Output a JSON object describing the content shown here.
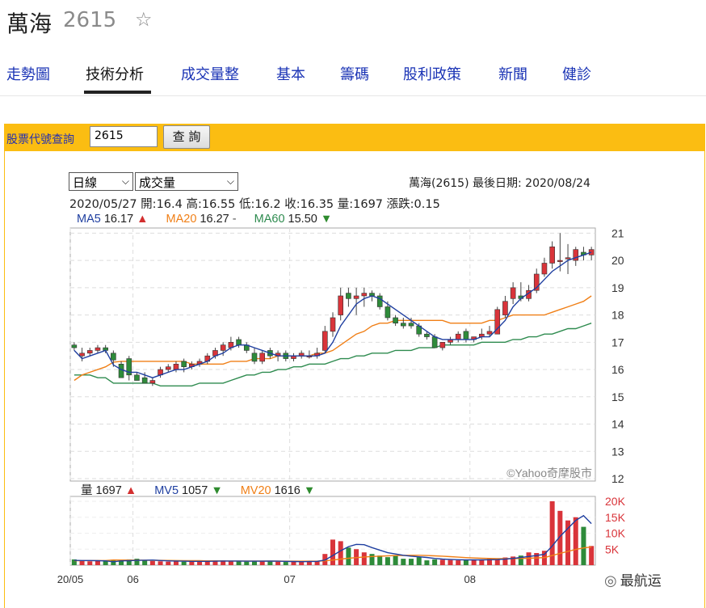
{
  "header": {
    "name": "萬海",
    "code": "2615"
  },
  "tabs": [
    "走勢圖",
    "技術分析",
    "成交量整",
    "基本",
    "籌碼",
    "股利政策",
    "新聞",
    "健診"
  ],
  "query": {
    "label": "股票代號查詢",
    "value": "2615",
    "button": "查 詢"
  },
  "selectors": {
    "period": "日線",
    "indicator": "成交量"
  },
  "info": {
    "title": "萬海(2615)   最後日期: 2020/08/24",
    "ohlc": "2020/05/27  開:16.4  高:16.55  低:16.2  收:16.35  量:1697  漲跌:0.15"
  },
  "ma_legend": [
    {
      "label": "MA5",
      "value": "16.17",
      "arrow": "▲",
      "color": "#1f3fa0",
      "arrow_color": "#d32f2f"
    },
    {
      "label": "MA20",
      "value": "16.27",
      "arrow": "-",
      "color": "#f07f16",
      "arrow_color": "#555555"
    },
    {
      "label": "MA60",
      "value": "15.50",
      "arrow": "▼",
      "color": "#2e8b4f",
      "arrow_color": "#2e8b2e"
    }
  ],
  "vol_legend": [
    {
      "label": "量",
      "value": "1697",
      "arrow": "▲",
      "color": "#222222",
      "arrow_color": "#d32f2f"
    },
    {
      "label": "MV5",
      "value": "1057",
      "arrow": "▼",
      "color": "#1f3fa0",
      "arrow_color": "#2e8b2e"
    },
    {
      "label": "MV20",
      "value": "1616",
      "arrow": "▼",
      "color": "#f07f16",
      "arrow_color": "#2e8b2e"
    }
  ],
  "watermark_chart": "©Yahoo奇摩股市",
  "watermark_corner": "最航运",
  "colors": {
    "up": "#d9343a",
    "down": "#2e8b3a",
    "ma5": "#1f3fa0",
    "ma20": "#f07f16",
    "ma60": "#2e8b4f",
    "vtick": "#d9343a"
  },
  "chart_data": {
    "type": "candlestick",
    "dates": [
      "05/20",
      "05/21",
      "05/22",
      "05/25",
      "05/26",
      "05/27",
      "05/28",
      "05/29",
      "06/01",
      "06/02",
      "06/03",
      "06/04",
      "06/05",
      "06/08",
      "06/09",
      "06/10",
      "06/11",
      "06/12",
      "06/15",
      "06/16",
      "06/17",
      "06/18",
      "06/19",
      "06/22",
      "06/23",
      "06/24",
      "06/29",
      "06/30",
      "07/01",
      "07/02",
      "07/03",
      "07/06",
      "07/07",
      "07/08",
      "07/09",
      "07/10",
      "07/13",
      "07/14",
      "07/15",
      "07/16",
      "07/17",
      "07/20",
      "07/21",
      "07/22",
      "07/23",
      "07/24",
      "07/27",
      "07/28",
      "07/29",
      "07/30",
      "07/31",
      "08/03",
      "08/04",
      "08/05",
      "08/06",
      "08/07",
      "08/10",
      "08/11",
      "08/12",
      "08/13",
      "08/14",
      "08/17",
      "08/18",
      "08/19",
      "08/20",
      "08/21",
      "08/24"
    ],
    "open": [
      16.9,
      16.5,
      16.6,
      16.7,
      16.8,
      16.6,
      16.2,
      16.4,
      15.8,
      15.7,
      15.5,
      15.8,
      16.0,
      16.0,
      16.3,
      16.1,
      16.2,
      16.3,
      16.5,
      16.7,
      16.8,
      17.1,
      16.9,
      16.6,
      16.3,
      16.7,
      16.5,
      16.6,
      16.4,
      16.5,
      16.5,
      16.5,
      16.7,
      17.4,
      18.0,
      18.8,
      18.6,
      18.7,
      18.8,
      18.7,
      18.3,
      17.9,
      17.7,
      17.7,
      17.6,
      17.3,
      17.2,
      16.8,
      17.0,
      17.1,
      17.4,
      17.1,
      17.2,
      17.3,
      17.3,
      18.0,
      18.6,
      18.7,
      18.6,
      18.9,
      19.5,
      19.9,
      20.0,
      20.1,
      20.0,
      20.3,
      20.2
    ],
    "high": [
      17.0,
      16.8,
      16.8,
      16.9,
      16.9,
      16.7,
      16.3,
      16.5,
      15.9,
      15.9,
      15.7,
      16.1,
      16.2,
      16.3,
      16.4,
      16.3,
      16.4,
      16.6,
      16.8,
      17.0,
      17.2,
      17.2,
      17.0,
      16.8,
      16.7,
      16.8,
      16.7,
      16.7,
      16.6,
      16.7,
      16.7,
      16.8,
      17.6,
      18.1,
      19.0,
      19.0,
      19.0,
      19.0,
      18.9,
      18.8,
      18.5,
      18.0,
      17.9,
      17.9,
      17.7,
      17.4,
      17.3,
      17.0,
      17.2,
      17.4,
      17.5,
      17.2,
      17.5,
      17.6,
      18.3,
      18.7,
      19.2,
      19.2,
      19.1,
      19.7,
      20.1,
      20.7,
      21.0,
      20.6,
      20.5,
      20.5,
      20.5
    ],
    "low": [
      16.7,
      16.3,
      16.5,
      16.6,
      16.6,
      16.1,
      15.7,
      15.6,
      15.6,
      15.5,
      15.4,
      15.7,
      15.9,
      15.9,
      15.9,
      16.0,
      16.1,
      16.2,
      16.4,
      16.5,
      16.7,
      16.8,
      16.6,
      16.2,
      16.2,
      16.4,
      16.3,
      16.3,
      16.3,
      16.4,
      16.4,
      16.4,
      16.6,
      17.2,
      17.8,
      18.3,
      18.0,
      18.3,
      18.5,
      18.2,
      17.8,
      17.6,
      17.5,
      17.5,
      17.2,
      17.1,
      16.8,
      16.7,
      16.9,
      17.0,
      17.0,
      17.0,
      17.1,
      17.2,
      17.3,
      17.9,
      18.4,
      18.5,
      18.5,
      18.8,
      19.4,
      19.7,
      19.6,
      19.5,
      19.8,
      20.0,
      20.0
    ],
    "close": [
      16.8,
      16.6,
      16.7,
      16.8,
      16.7,
      16.35,
      15.7,
      15.8,
      15.6,
      15.5,
      15.6,
      16.0,
      16.1,
      16.2,
      16.1,
      16.2,
      16.3,
      16.5,
      16.7,
      16.9,
      17.0,
      16.9,
      16.7,
      16.3,
      16.6,
      16.5,
      16.6,
      16.4,
      16.5,
      16.6,
      16.5,
      16.6,
      17.4,
      17.9,
      18.7,
      18.6,
      18.7,
      18.8,
      18.7,
      18.3,
      17.9,
      17.7,
      17.6,
      17.6,
      17.3,
      17.2,
      16.8,
      17.0,
      17.1,
      17.3,
      17.1,
      17.2,
      17.3,
      17.4,
      18.2,
      18.5,
      19.0,
      18.6,
      18.9,
      19.5,
      19.9,
      20.5,
      20.0,
      20.1,
      20.4,
      20.2,
      20.4
    ],
    "ma5": [
      16.7,
      16.4,
      16.5,
      16.6,
      16.7,
      16.17,
      16.0,
      15.9,
      15.9,
      15.8,
      15.7,
      15.8,
      15.9,
      16.0,
      16.0,
      16.1,
      16.2,
      16.3,
      16.5,
      16.6,
      16.8,
      16.9,
      16.9,
      16.8,
      16.7,
      16.6,
      16.5,
      16.5,
      16.5,
      16.5,
      16.5,
      16.5,
      16.6,
      17.0,
      17.6,
      18.0,
      18.4,
      18.6,
      18.7,
      18.6,
      18.4,
      18.2,
      18.0,
      17.8,
      17.6,
      17.4,
      17.2,
      17.1,
      17.1,
      17.1,
      17.1,
      17.1,
      17.2,
      17.2,
      17.5,
      17.8,
      18.3,
      18.6,
      18.8,
      19.0,
      19.3,
      19.6,
      19.8,
      20.0,
      20.1,
      20.2,
      20.3
    ],
    "ma20": [
      15.6,
      15.8,
      15.9,
      16.0,
      16.1,
      16.27,
      16.3,
      16.3,
      16.3,
      16.3,
      16.3,
      16.3,
      16.3,
      16.3,
      16.3,
      16.2,
      16.2,
      16.2,
      16.2,
      16.2,
      16.3,
      16.3,
      16.3,
      16.4,
      16.4,
      16.4,
      16.5,
      16.5,
      16.5,
      16.5,
      16.5,
      16.6,
      16.6,
      16.7,
      16.9,
      17.1,
      17.3,
      17.4,
      17.6,
      17.7,
      17.7,
      17.8,
      17.8,
      17.8,
      17.8,
      17.8,
      17.8,
      17.8,
      17.7,
      17.7,
      17.7,
      17.7,
      17.7,
      17.8,
      17.8,
      17.9,
      18.0,
      18.0,
      18.0,
      18.0,
      18.0,
      18.1,
      18.2,
      18.3,
      18.4,
      18.5,
      18.7
    ],
    "ma60": [
      15.8,
      15.8,
      15.8,
      15.7,
      15.7,
      15.5,
      15.5,
      15.5,
      15.5,
      15.5,
      15.5,
      15.4,
      15.4,
      15.4,
      15.4,
      15.4,
      15.5,
      15.5,
      15.5,
      15.5,
      15.6,
      15.7,
      15.8,
      15.8,
      15.9,
      15.9,
      16.0,
      16.0,
      16.1,
      16.1,
      16.2,
      16.2,
      16.2,
      16.3,
      16.4,
      16.4,
      16.5,
      16.5,
      16.6,
      16.6,
      16.6,
      16.7,
      16.7,
      16.7,
      16.8,
      16.8,
      16.8,
      16.9,
      16.9,
      16.9,
      16.9,
      16.9,
      17.0,
      17.0,
      17.0,
      17.0,
      17.1,
      17.1,
      17.2,
      17.2,
      17.3,
      17.3,
      17.4,
      17.5,
      17.5,
      17.6,
      17.7
    ],
    "volume": [
      1800,
      1500,
      1200,
      1400,
      1300,
      1697,
      1500,
      1800,
      2000,
      1400,
      1300,
      1200,
      1100,
      1300,
      1100,
      1200,
      1300,
      1200,
      1400,
      1500,
      1300,
      1200,
      1100,
      1300,
      1400,
      1200,
      1100,
      1000,
      1100,
      1200,
      1400,
      1300,
      3500,
      8000,
      7500,
      5500,
      5000,
      4000,
      3500,
      3000,
      2500,
      3000,
      2000,
      2000,
      2500,
      1500,
      1800,
      1700,
      1600,
      1500,
      1700,
      1800,
      1600,
      2000,
      1800,
      2400,
      2700,
      3000,
      4000,
      3800,
      4500,
      20000,
      17000,
      14000,
      15000,
      12000,
      6000
    ],
    "mv5": [
      1500,
      1450,
      1450,
      1400,
      1350,
      1057,
      1350,
      1400,
      1500,
      1550,
      1600,
      1450,
      1350,
      1300,
      1250,
      1200,
      1200,
      1200,
      1250,
      1300,
      1300,
      1300,
      1250,
      1250,
      1250,
      1300,
      1250,
      1200,
      1150,
      1100,
      1150,
      1200,
      1600,
      3000,
      4500,
      5800,
      6500,
      6400,
      5500,
      4700,
      3900,
      3500,
      3100,
      2800,
      2600,
      2400,
      2100,
      1900,
      1800,
      1700,
      1650,
      1650,
      1650,
      1700,
      1750,
      1900,
      2100,
      2400,
      2700,
      3000,
      3400,
      6000,
      9000,
      11500,
      14000,
      15500,
      13000
    ],
    "mv20": [
      1400,
      1420,
      1430,
      1440,
      1450,
      1616,
      1600,
      1600,
      1580,
      1550,
      1520,
      1500,
      1480,
      1450,
      1420,
      1400,
      1380,
      1350,
      1330,
      1320,
      1300,
      1300,
      1290,
      1280,
      1280,
      1270,
      1260,
      1250,
      1240,
      1230,
      1230,
      1230,
      1350,
      1600,
      1900,
      2150,
      2350,
      2550,
      2700,
      2800,
      2900,
      3000,
      3050,
      3100,
      3100,
      3000,
      2900,
      2800,
      2650,
      2500,
      2350,
      2250,
      2150,
      2100,
      2050,
      2050,
      2050,
      2100,
      2150,
      2250,
      2350,
      3000,
      3700,
      4300,
      4900,
      5400,
      5700
    ],
    "price_ticks": [
      21,
      20,
      19,
      18,
      17,
      16,
      15,
      14,
      13,
      12
    ],
    "volume_ticks": [
      "20K",
      "15K",
      "10K",
      "5K"
    ],
    "x_ticks": [
      {
        "date": "05/20",
        "label": "20/05"
      },
      {
        "date": "06/01",
        "label": "06"
      },
      {
        "date": "07/01",
        "label": "07"
      },
      {
        "date": "08/03",
        "label": "08"
      }
    ],
    "price_range": [
      12,
      21.1
    ],
    "volume_range": [
      0,
      20000
    ]
  }
}
